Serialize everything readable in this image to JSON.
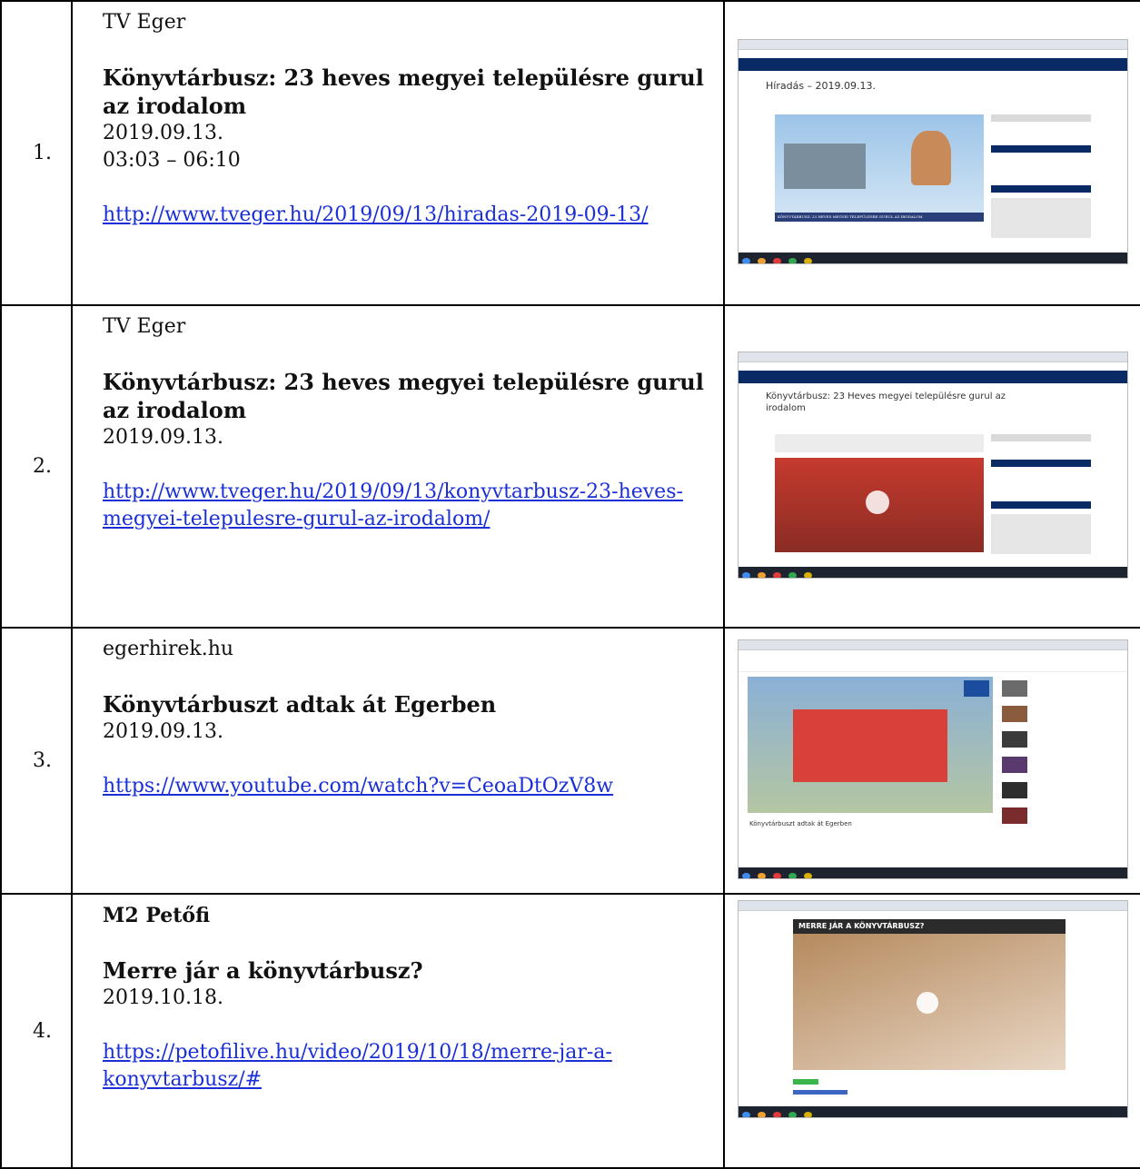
{
  "rows": [
    {
      "num": "1.",
      "source": "TV Eger",
      "source_bold": false,
      "title": "Könyvtárbusz: 23 heves megyei településre gurul az irodalom",
      "date": "2019.09.13.",
      "time": "03:03 – 06:10",
      "url": "http://www.tveger.hu/2019/09/13/hiradas-2019-09-13/",
      "screenshot": {
        "heading": "Híradás – 2019.09.13.",
        "caption": "KÖNYVTÁRBUSZ: 23 HEVES MEGYEI TELEPÜLÉSRE GURUL AZ IRODALOM"
      }
    },
    {
      "num": "2.",
      "source": "TV Eger",
      "source_bold": false,
      "title": "Könyvtárbusz: 23 heves megyei településre gurul az irodalom",
      "date": "2019.09.13.",
      "time": "",
      "url": "http://www.tveger.hu/2019/09/13/konyvtarbusz-23-heves-megyei-telepulesre-gurul-az-irodalom/",
      "screenshot": {
        "heading": "Könyvtárbusz: 23 Heves megyei településre gurul az irodalom"
      }
    },
    {
      "num": "3.",
      "source": "egerhirek.hu",
      "source_bold": false,
      "title": "Könyvtárbuszt adtak át Egerben",
      "date": "2019.09.13.",
      "time": "",
      "url": "https://www.youtube.com/watch?v=CeoaDtOzV8w",
      "screenshot": {
        "heading": "Könyvtárbuszt adtak át Egerben"
      }
    },
    {
      "num": "4.",
      "source": "M2 Petőfi",
      "source_bold": true,
      "title": "Merre jár a könyvtárbusz?",
      "date": "2019.10.18.",
      "time": "",
      "url": "https://petofilive.hu/video/2019/10/18/merre-jar-a-konyvtarbusz/#",
      "screenshot": {
        "heading": "MERRE JÁR A KÖNYVTÁRBUSZ?"
      }
    }
  ],
  "colors": {
    "link": "#1a2fd6",
    "nav": "#0a2a66",
    "border": "#000000"
  }
}
